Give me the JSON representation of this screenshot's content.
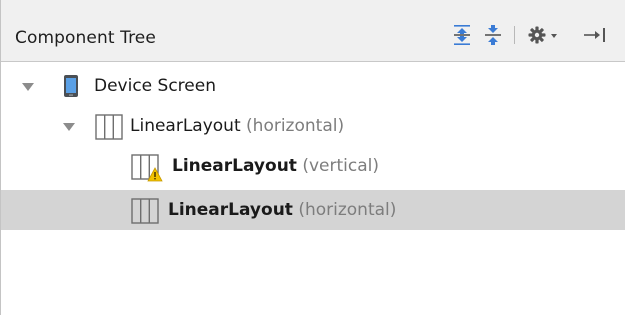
{
  "panel": {
    "title": "Component Tree"
  },
  "toolbar": {
    "icons": [
      "expand-all-icon",
      "collapse-all-icon",
      "gear-icon",
      "pin-to-side-icon"
    ]
  },
  "tree": {
    "rows": [
      {
        "name": "Device Screen",
        "hint": "",
        "expanded": true,
        "selected": false,
        "warning": false
      },
      {
        "name": "LinearLayout",
        "hint": "(horizontal)",
        "expanded": true,
        "selected": false,
        "warning": false
      },
      {
        "name": "LinearLayout",
        "hint": "(vertical)",
        "expanded": false,
        "selected": false,
        "warning": true
      },
      {
        "name": "LinearLayout",
        "hint": "(horizontal)",
        "expanded": false,
        "selected": true,
        "warning": false
      }
    ]
  },
  "colors": {
    "header_bg": "#f0f0f0",
    "selected_row": "#d4d4d4",
    "hint_text": "#7d7d7d",
    "accent_blue": "#3a7bd5",
    "warning_yellow": "#f2c200"
  }
}
